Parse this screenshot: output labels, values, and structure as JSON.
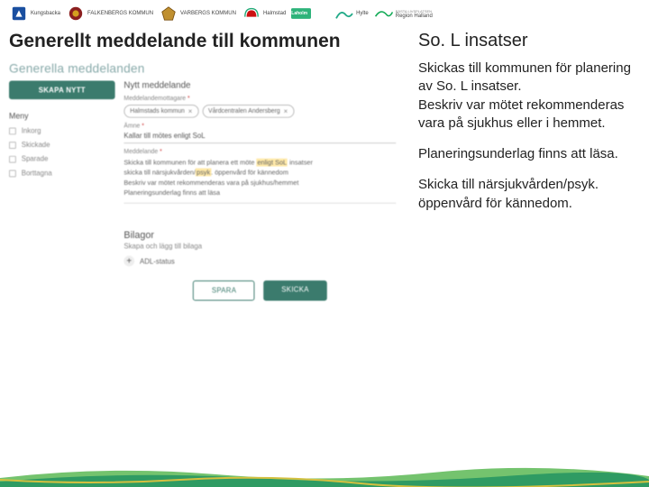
{
  "logos": {
    "kungsbacka": "Kungsbacka",
    "falkenberg": "FALKENBERGS KOMMUN",
    "varberg": "VARBERGS KOMMUN",
    "halmstad": "Halmstad",
    "laholm": "Laholm",
    "hylte": "Hylte",
    "region": "Region Halland",
    "region_sub": "BÄSTA LIVSPLATSEN"
  },
  "titles": {
    "left": "Generellt meddelande till kommunen",
    "right": "So. L insatser"
  },
  "app": {
    "header": "Generella meddelanden",
    "skapa": "SKAPA NYTT",
    "menu_label": "Meny",
    "menu": [
      {
        "label": "Inkorg"
      },
      {
        "label": "Skickade"
      },
      {
        "label": "Sparade"
      },
      {
        "label": "Borttagna"
      }
    ],
    "section": "Nytt meddelande",
    "recipients_label": "Meddelandemottagare",
    "chips": [
      "Halmstads kommun",
      "Vårdcentralen Andersberg"
    ],
    "subject_label": "Ämne",
    "subject_value": "Kallar till mötes enligt SoL",
    "message_label": "Meddelande",
    "message_lines": {
      "l1a": "Skicka till kommunen för att planera ett möte ",
      "l1hl": "enligt SoL",
      "l1b": " insatser",
      "l2a": "skicka till närsjukvården/",
      "l2hl": "psyk",
      "l2b": ". öppenvård för kännedom",
      "l3": "Beskriv var mötet rekommenderas vara på sjukhus/hemmet",
      "l4": "Planeringsunderlag finns att läsa"
    },
    "bilagor_title": "Bilagor",
    "bilagor_sub": "Skapa och lägg till bilaga",
    "adl": "ADL-status",
    "btn_save": "SPARA",
    "btn_send": "SKICKA"
  },
  "text": {
    "p1": "Skickas till kommunen för  planering av So. L insatser.\nBeskriv  var  mötet rekommenderas vara på sjukhus eller i hemmet.",
    "p2": "Planeringsunderlag finns att läsa.",
    "p3": "Skicka till närsjukvården/psyk. öppenvård för kännedom."
  },
  "chart_data": null
}
